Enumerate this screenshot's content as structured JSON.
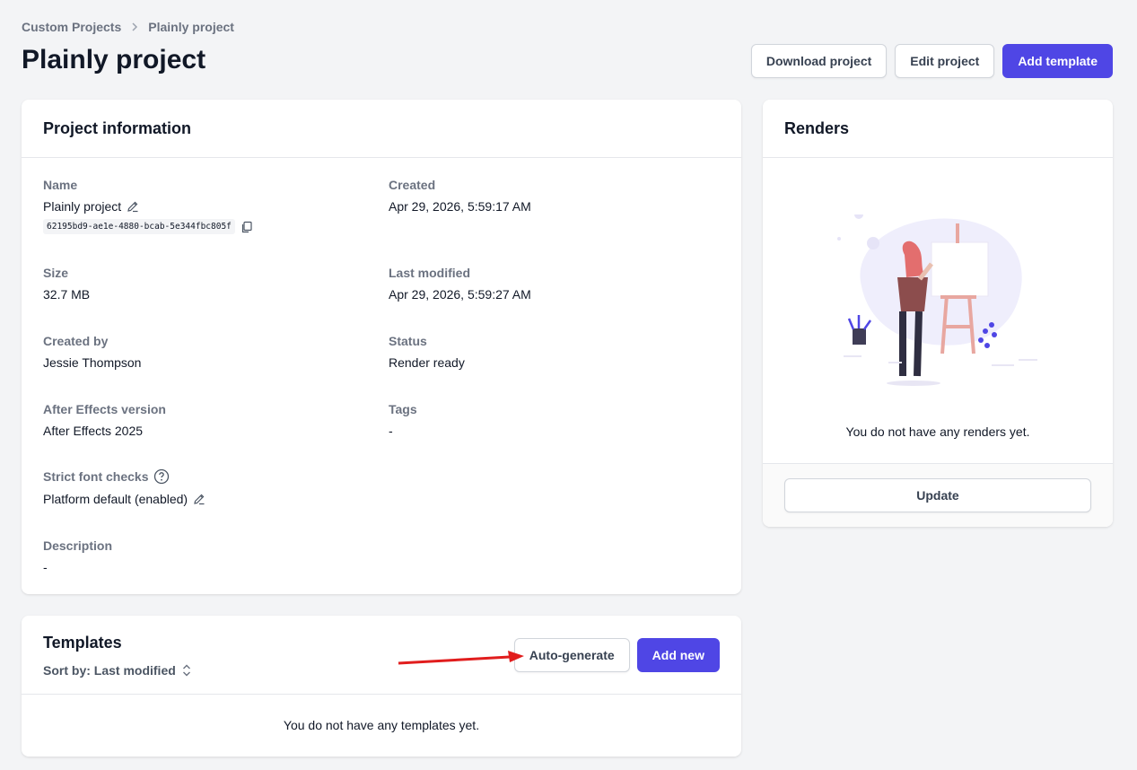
{
  "breadcrumb": {
    "parent": "Custom Projects",
    "current": "Plainly project"
  },
  "page_title": "Plainly project",
  "header_actions": {
    "download": "Download project",
    "edit": "Edit project",
    "add_template": "Add template"
  },
  "project_info": {
    "title": "Project information",
    "name_label": "Name",
    "name_value": "Plainly project",
    "uuid": "62195bd9-ae1e-4880-bcab-5e344fbc805f",
    "created_label": "Created",
    "created_value": "Apr 29, 2026, 5:59:17 AM",
    "size_label": "Size",
    "size_value": "32.7 MB",
    "last_modified_label": "Last modified",
    "last_modified_value": "Apr 29, 2026, 5:59:27 AM",
    "created_by_label": "Created by",
    "created_by_value": "Jessie Thompson",
    "status_label": "Status",
    "status_value": "Render ready",
    "ae_version_label": "After Effects version",
    "ae_version_value": "After Effects 2025",
    "tags_label": "Tags",
    "tags_value": "-",
    "strict_font_label": "Strict font checks",
    "strict_font_value": "Platform default (enabled)",
    "description_label": "Description",
    "description_value": "-"
  },
  "renders": {
    "title": "Renders",
    "empty_text": "You do not have any renders yet.",
    "update_label": "Update"
  },
  "templates": {
    "title": "Templates",
    "sort_label": "Sort by: Last modified",
    "auto_generate": "Auto-generate",
    "add_new": "Add new",
    "empty_text": "You do not have any templates yet."
  },
  "colors": {
    "primary": "#4f46e5",
    "background": "#f3f4f6",
    "annotation_arrow": "#e11d1d"
  }
}
